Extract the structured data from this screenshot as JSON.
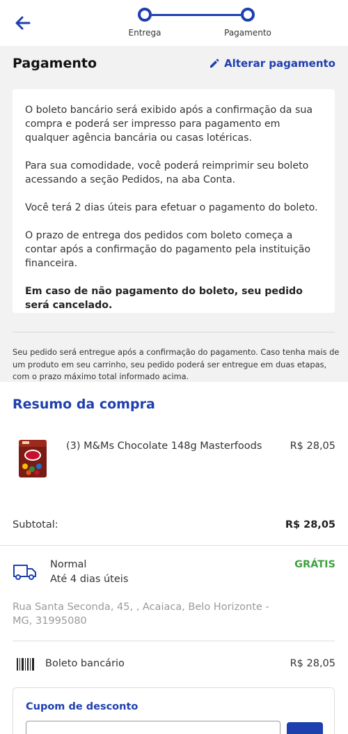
{
  "colors": {
    "brand": "#1e3fae",
    "free_shipping": "#3ea23e",
    "muted": "#9a9a9a",
    "section_bg": "#f2f2f2"
  },
  "header": {
    "back_icon": "arrow-left-icon",
    "steps": [
      {
        "label": "Entrega"
      },
      {
        "label": "Pagamento"
      }
    ]
  },
  "payment": {
    "title": "Pagamento",
    "change_label": "Alterar pagamento",
    "change_icon": "pencil-icon",
    "info": [
      "O boleto bancário será exibido após a confirmação da sua compra e poderá ser impresso para pagamento em qualquer agência bancária ou casas lotéricas.",
      "Para sua comodidade, você poderá reimprimir seu boleto acessando a seção Pedidos, na aba Conta.",
      "Você terá 2 dias úteis para efetuar o pagamento do boleto.",
      "O prazo de entrega dos pedidos com boleto começa a contar após a confirmação do pagamento pela instituição financeira."
    ],
    "warning": "Em caso de não pagamento do boleto, seu pedido será cancelado.",
    "note": "Seu pedido será entregue após a confirmação do pagamento. Caso tenha mais de um produto em seu carrinho, seu pedido poderá ser entregue em duas etapas, com o prazo máximo total informado acima."
  },
  "summary": {
    "title": "Resumo da compra",
    "product": {
      "name": "(3) M&Ms Chocolate 148g Masterfoods",
      "price": "R$ 28,05"
    },
    "subtotal_label": "Subtotal:",
    "subtotal_value": "R$ 28,05",
    "shipping": {
      "icon": "truck-icon",
      "name": "Normal",
      "time": "Até 4 dias úteis",
      "price": "GRÁTIS"
    },
    "address": "Rua Santa Seconda, 45, , Acaiaca, Belo Horizonte - MG, 31995080",
    "payment_method": {
      "icon": "barcode-icon",
      "name": "Boleto bancário",
      "value": "R$ 28,05"
    }
  },
  "coupon": {
    "title": "Cupom de desconto",
    "value": "",
    "button_label": ""
  }
}
